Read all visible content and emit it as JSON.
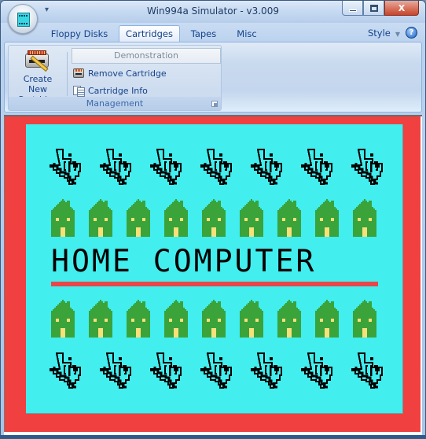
{
  "window": {
    "title": "Win994a Simulator - v3.009",
    "controls": {
      "minimize": "minimize",
      "maximize": "maximize",
      "close": "X"
    }
  },
  "app_menu": {
    "icon": "ti-cartridge-orb-icon"
  },
  "quick_access": {
    "dropdown_glyph": "▾"
  },
  "tabs": [
    {
      "label": "Floppy Disks",
      "active": false
    },
    {
      "label": "Cartridges",
      "active": true
    },
    {
      "label": "Tapes",
      "active": false
    },
    {
      "label": "Misc",
      "active": false
    }
  ],
  "style_menu": {
    "label": "Style",
    "arrow": "▼"
  },
  "help": {
    "glyph": "?"
  },
  "ribbon": {
    "group": {
      "label": "Management",
      "create_new_line1": "Create New",
      "create_new_line2": "Cartridge",
      "selected_cartridge": "Demonstration",
      "remove_cartridge": "Remove Cartridge",
      "cartridge_info": "Cartridge Info"
    }
  },
  "emulator": {
    "headline": "HOME COMPUTER",
    "colors": {
      "border": "#f04040",
      "background": "#42eeee",
      "house": "#3aa33a",
      "window": "#f8e07a",
      "text": "#000000",
      "underline": "#e8474a"
    },
    "rows": [
      {
        "sprite": "ti-logo",
        "count": 7
      },
      {
        "sprite": "house",
        "count": 9
      },
      {
        "sprite": "house",
        "count": 9
      },
      {
        "sprite": "ti-logo",
        "count": 7
      }
    ]
  }
}
